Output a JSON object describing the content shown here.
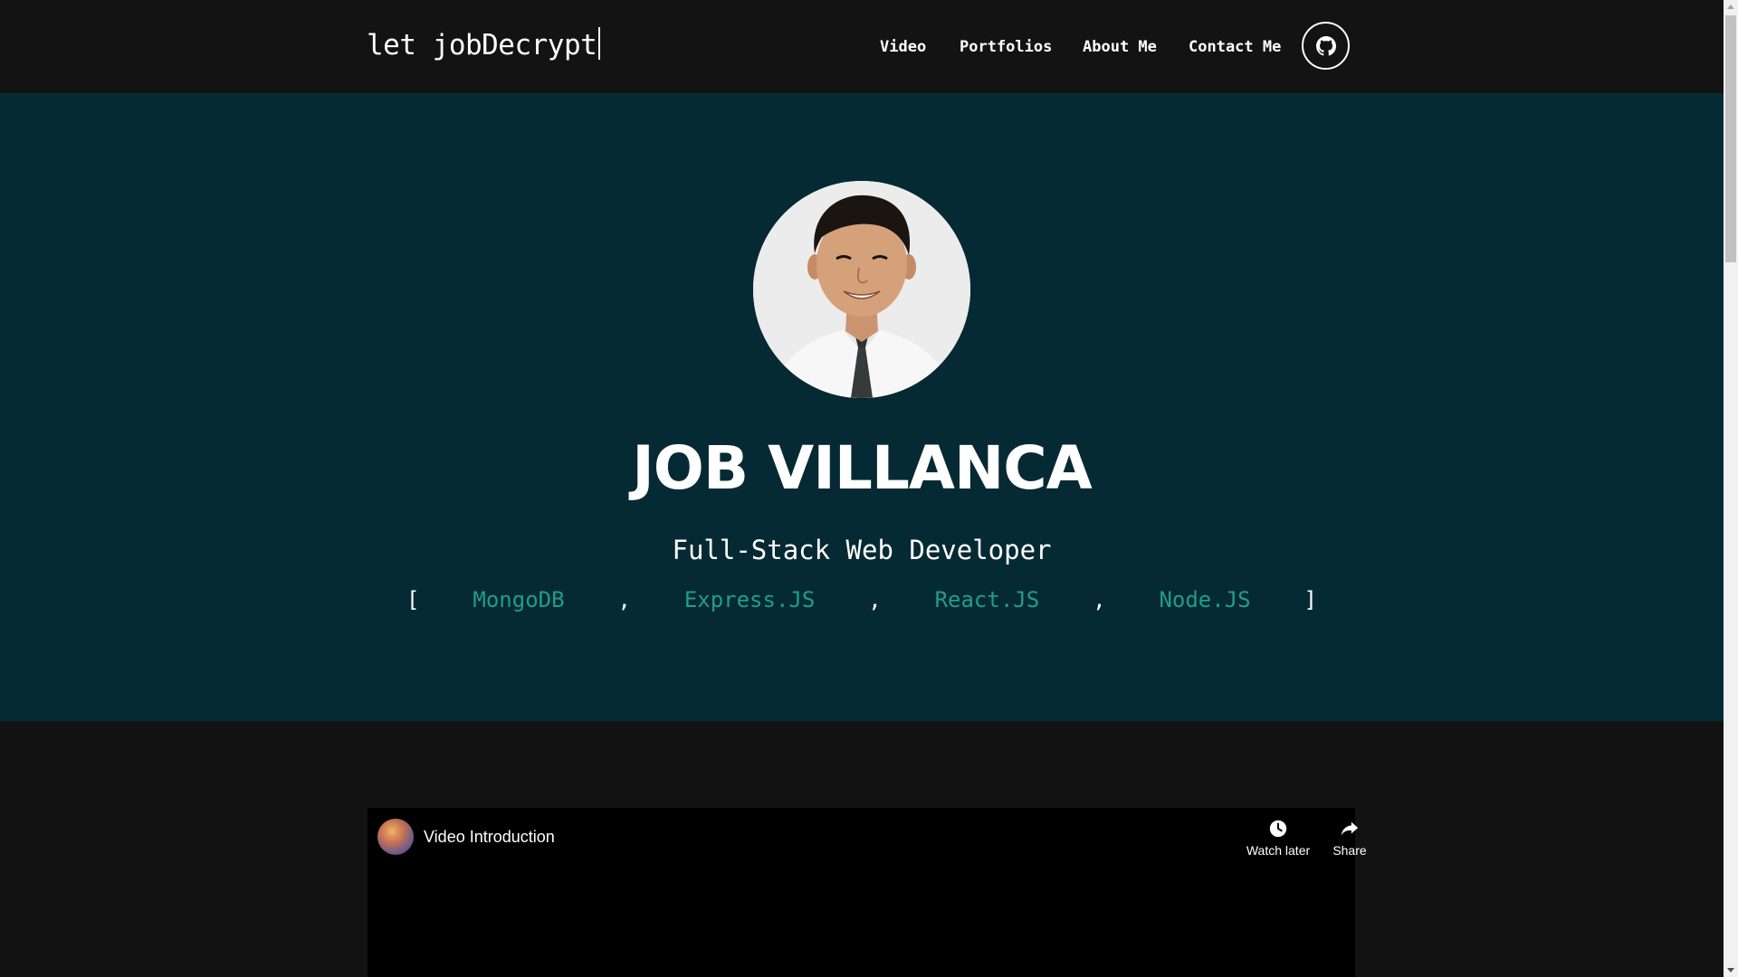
{
  "navbar": {
    "brand": "let jobDecrypt",
    "links": [
      "Video",
      "Portfolios",
      "About Me",
      "Contact Me"
    ],
    "github_icon": "github-icon"
  },
  "hero": {
    "name": "JOB VILLANCA",
    "role": "Full-Stack Web Developer",
    "stack": {
      "open": "[",
      "items": [
        "MongoDB",
        "Express.JS",
        "React.JS",
        "Node.JS"
      ],
      "separator": ",",
      "close": "]"
    }
  },
  "video": {
    "title": "Video Introduction",
    "watch_later": "Watch later",
    "share": "Share"
  },
  "colors": {
    "navbar_bg": "#131313",
    "hero_bg": "#062a33",
    "accent": "#1f9e88",
    "page_bg": "#121212"
  }
}
